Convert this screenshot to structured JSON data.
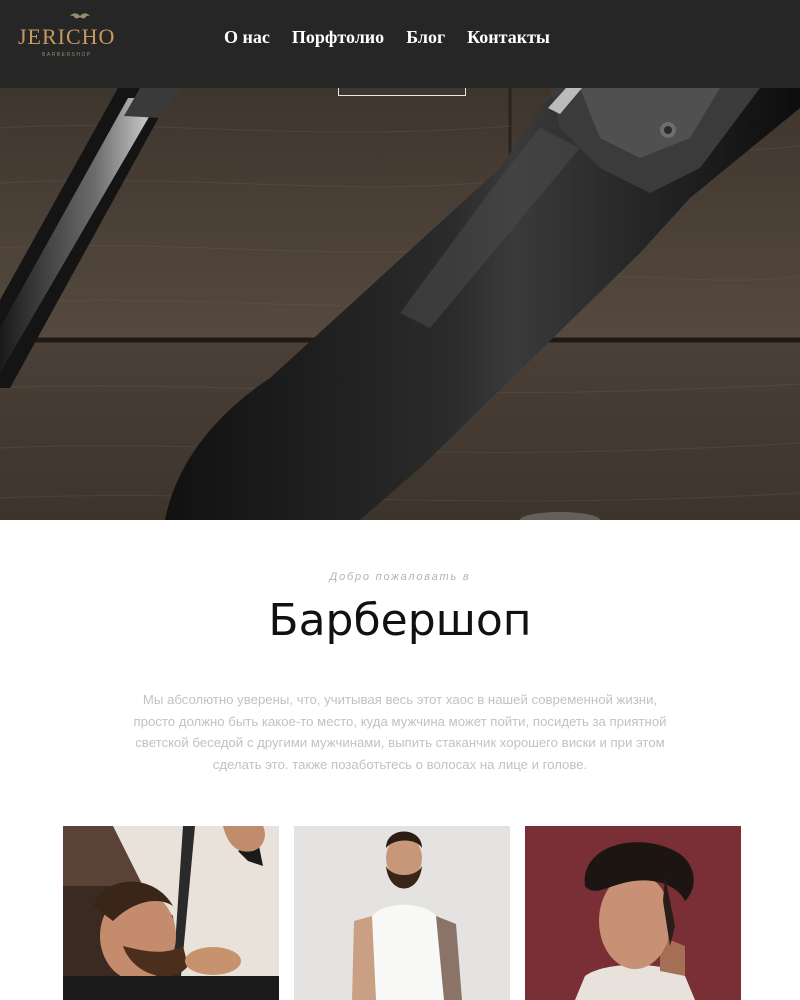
{
  "header": {
    "logo_text": "JERICHO",
    "logo_subtext": "BARBERSHOP",
    "nav": [
      {
        "label": "О нас"
      },
      {
        "label": "Порфтолио"
      },
      {
        "label": "Блог"
      },
      {
        "label": "Контакты"
      }
    ]
  },
  "welcome": {
    "subtitle": "Добро пожаловать в",
    "title": "Барбершоп",
    "text": "Мы абсолютно уверены, что, учитывая весь этот хаос в нашей современной жизни, просто должно быть какое-то место, куда мужчина может пойти, посидеть за приятной светской беседой с другими мужчинами, выпить стаканчик хорошего виски и при этом сделать это. также позаботьтесь о волосах на лице и голове."
  },
  "colors": {
    "header_bg": "#262626",
    "logo_gold": "#c49a5e",
    "hero_wood": "#4a3f35",
    "title_text": "#111111",
    "body_text": "#c2c2c2",
    "gallery_bg_3": "#7a2e36"
  },
  "icons": {
    "logo_mark": "mustache-icon"
  }
}
